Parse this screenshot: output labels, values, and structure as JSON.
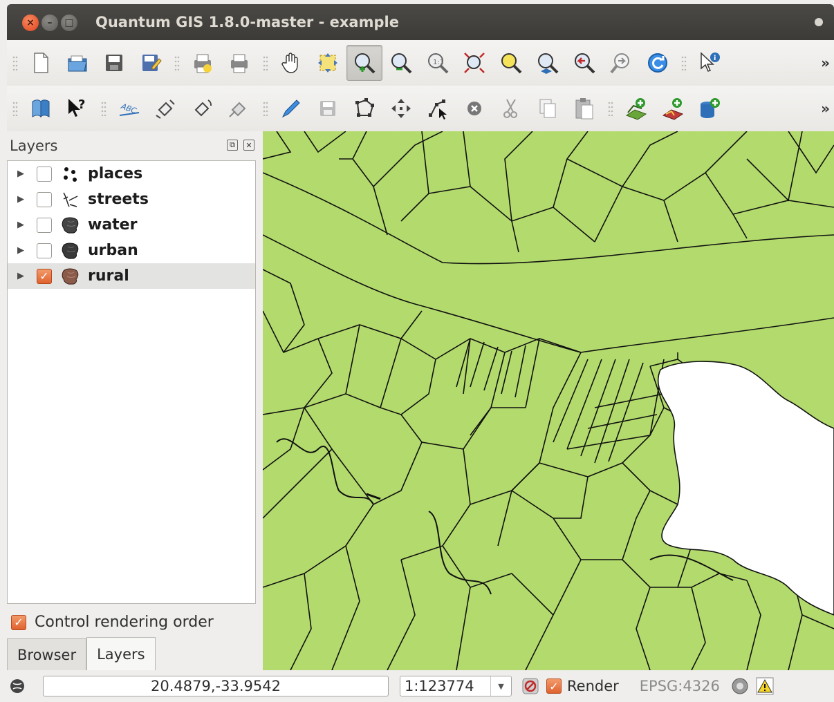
{
  "window": {
    "title": "Quantum GIS 1.8.0-master - example"
  },
  "toolbar1": {
    "icons": [
      "new-project-icon",
      "open-project-icon",
      "save-project-icon",
      "save-as-icon",
      "new-print-composer-icon",
      "print-icon",
      "pan-map-icon",
      "pan-to-selection-icon",
      "zoom-in-icon",
      "zoom-out-icon",
      "zoom-actual-size-icon",
      "zoom-full-icon",
      "zoom-to-selection-icon",
      "zoom-to-layer-icon",
      "zoom-last-icon",
      "zoom-next-icon",
      "refresh-icon",
      "identify-icon"
    ],
    "more": "»"
  },
  "toolbar2": {
    "icons": [
      "help-contents-icon",
      "whats-this-icon",
      "label-tool-icon",
      "move-label-icon",
      "rotate-label-icon",
      "change-label-icon",
      "toggle-editing-icon",
      "save-edits-icon",
      "add-feature-icon",
      "move-feature-icon",
      "node-tool-icon",
      "delete-selected-icon",
      "cut-features-icon",
      "copy-features-icon",
      "paste-features-icon",
      "add-vector-layer-icon",
      "add-raster-layer-icon",
      "add-postgis-layer-icon"
    ],
    "more": "»"
  },
  "panel": {
    "title": "Layers",
    "layers": [
      {
        "name": "places",
        "checked": false,
        "icon": "point-layer-icon"
      },
      {
        "name": "streets",
        "checked": false,
        "icon": "line-layer-icon"
      },
      {
        "name": "water",
        "checked": false,
        "icon": "polygon-layer-icon"
      },
      {
        "name": "urban",
        "checked": false,
        "icon": "polygon-layer-icon"
      },
      {
        "name": "rural",
        "checked": true,
        "icon": "polygon-layer-icon"
      }
    ],
    "control_rendering_order": "Control rendering order",
    "tabs": [
      "Browser",
      "Layers"
    ]
  },
  "status": {
    "coordinates": "20.4879,-33.9542",
    "scale": "1:123774",
    "render_label": "Render",
    "crs": "EPSG:4326"
  },
  "colors": {
    "map_fill": "#b2da6c",
    "accent": "#e0622e"
  }
}
